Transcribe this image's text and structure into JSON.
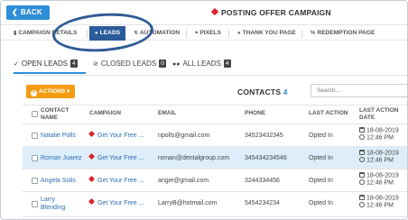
{
  "header": {
    "back_label": "BACK",
    "page_title": "POSTING OFFER CAMPAIGN"
  },
  "nav": {
    "items": [
      {
        "label": "CAMPAIGN DETAILS",
        "icon": "bar-chart-icon"
      },
      {
        "label": "LEADS",
        "icon": "users-icon",
        "active": true
      },
      {
        "label": "AUTOMATION",
        "icon": "bolt-icon"
      },
      {
        "label": "PIXELS",
        "icon": "crosshair-icon"
      },
      {
        "label": "THANK YOU PAGE",
        "icon": "circle-icon"
      },
      {
        "label": "REDEMPTION PAGE",
        "icon": "percent-icon"
      }
    ]
  },
  "subtabs": [
    {
      "label": "OPEN LEADS",
      "count": "4",
      "icon": "check-icon",
      "active": true
    },
    {
      "label": "CLOSED LEADS",
      "count": "0",
      "icon": "circle-x-icon"
    },
    {
      "label": "ALL LEADS",
      "count": "4",
      "icon": "users-icon"
    }
  ],
  "panel": {
    "actions_label": "ACTIONS",
    "contacts_label": "CONTACTS",
    "contacts_count": "4",
    "search_placeholder": "Search..."
  },
  "table": {
    "columns": [
      "CONTACT NAME",
      "CAMPAIGN",
      "EMAIL",
      "PHONE",
      "LAST ACTION",
      "LAST ACTION DATE"
    ],
    "rows": [
      {
        "name": "Natalie Polls",
        "campaign": "Get Your Free ...",
        "email": "npolls@gmail.com",
        "phone": "34523432345",
        "last_action": "Opted In",
        "date": "18-08-2019",
        "time": "12:46 PM",
        "highlighted": false
      },
      {
        "name": "Roman Juarez",
        "campaign": "Get Your Free ...",
        "email": "roman@dentalgroup.com",
        "phone": "345434234546",
        "last_action": "Opted In",
        "date": "18-08-2019",
        "time": "12:46 PM",
        "highlighted": true
      },
      {
        "name": "Angela Solis",
        "campaign": "Get Your Free ...",
        "email": "angie@gmail.com",
        "phone": "3244334456",
        "last_action": "Opted In",
        "date": "18-08-2019",
        "time": "12:46 PM",
        "highlighted": false
      },
      {
        "name": "Larry Blending",
        "campaign": "Get Your Free ...",
        "email": "LarryB@hotmail.com",
        "phone": "5454234234",
        "last_action": "Opted In",
        "date": "18-08-2019",
        "time": "12:46 PM",
        "highlighted": false
      }
    ]
  },
  "colors": {
    "primary": "#2f8ed6",
    "nav_active": "#2b5b9a",
    "actions": "#f39c12",
    "row_highlight": "#ddeefa",
    "tag": "#d9262c",
    "annotation_circle": "#2f5b93"
  }
}
